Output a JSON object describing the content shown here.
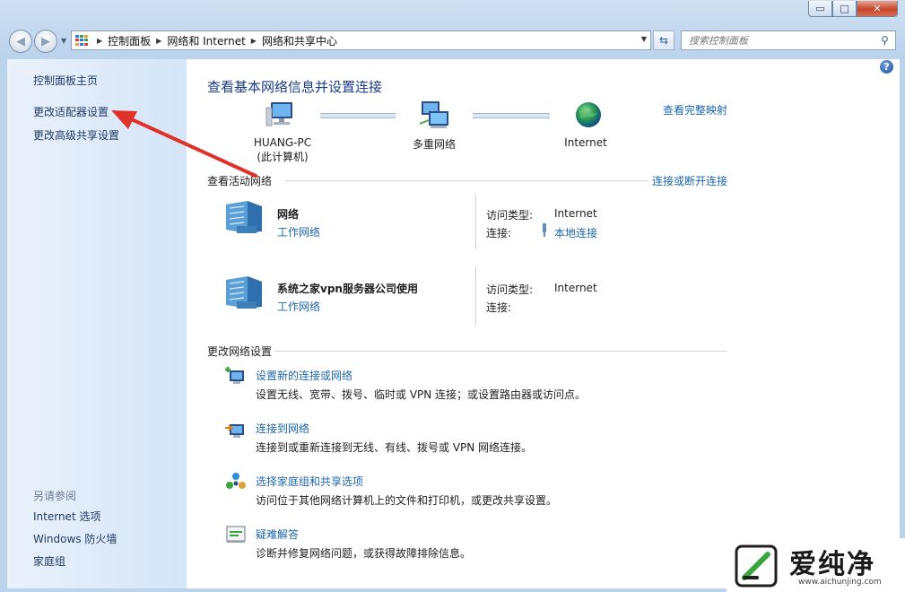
{
  "window": {
    "caption_buttons": {
      "minimize": "▭",
      "maximize": "□",
      "close": "✕"
    }
  },
  "nav": {
    "breadcrumbs": [
      "控制面板",
      "网络和 Internet",
      "网络和共享中心"
    ],
    "search_placeholder": "搜索控制面板"
  },
  "sidebar": {
    "items": [
      {
        "label": "控制面板主页"
      },
      {
        "label": "更改适配器设置"
      },
      {
        "label": "更改高级共享设置"
      }
    ],
    "see_also_title": "另请参阅",
    "see_also": [
      {
        "label": "Internet 选项"
      },
      {
        "label": "Windows 防火墙"
      },
      {
        "label": "家庭组"
      }
    ]
  },
  "main": {
    "title": "查看基本网络信息并设置连接",
    "view_full_map": "查看完整映射",
    "map": {
      "computer_name": "HUANG-PC",
      "computer_sub": "(此计算机)",
      "middle": "多重网络",
      "internet": "Internet"
    },
    "active_title": "查看活动网络",
    "connect_disconnect": "连接或断开连接",
    "networks": [
      {
        "name": "网络",
        "type": "工作网络",
        "access_label": "访问类型:",
        "access_value": "Internet",
        "conn_label": "连接:",
        "conn_value": "本地连接"
      },
      {
        "name": "系统之家vpn服务器公司使用",
        "type": "工作网络",
        "access_label": "访问类型:",
        "access_value": "Internet",
        "conn_label": "连接:",
        "conn_value": ""
      }
    ],
    "change_title": "更改网络设置",
    "tasks": [
      {
        "link": "设置新的连接或网络",
        "desc": "设置无线、宽带、拨号、临时或 VPN 连接；或设置路由器或访问点。",
        "icon": "new-connection-icon"
      },
      {
        "link": "连接到网络",
        "desc": "连接到或重新连接到无线、有线、拨号或 VPN 网络连接。",
        "icon": "connect-network-icon"
      },
      {
        "link": "选择家庭组和共享选项",
        "desc": "访问位于其他网络计算机上的文件和打印机，或更改共享设置。",
        "icon": "homegroup-icon"
      },
      {
        "link": "疑难解答",
        "desc": "诊断并修复网络问题，或获得故障排除信息。",
        "icon": "troubleshoot-icon"
      }
    ]
  },
  "watermark": {
    "brand": "爱纯净",
    "url": "www.aichunjing.com"
  },
  "colors": {
    "link": "#1e66aa",
    "title": "#1a3c8d",
    "sidebar_bg": "#dce9f7",
    "annotation_arrow": "#e0302a"
  }
}
